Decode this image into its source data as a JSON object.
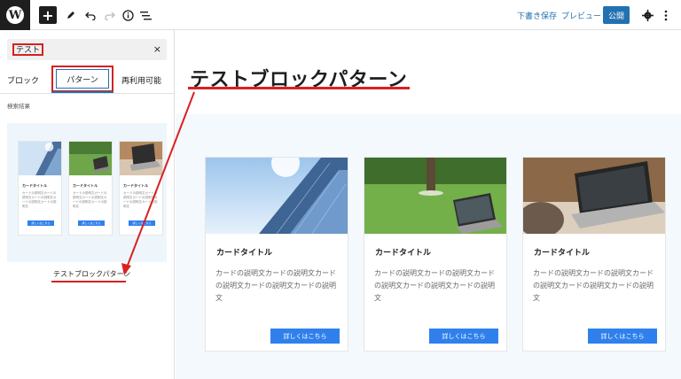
{
  "toolbar": {
    "logo": "W",
    "add_icon": "+",
    "draft_label": "下書き保存",
    "preview_label": "プレビュー",
    "publish_label": "公開"
  },
  "inserter": {
    "search_value": "テスト",
    "clear_icon": "×",
    "tabs": {
      "block": "ブロック",
      "pattern": "パターン",
      "reusable": "再利用可能"
    },
    "results_label": "検索結果",
    "pattern_name": "テストブロックパターン",
    "mini_cards": [
      {
        "title": "カードタイトル",
        "text": "カードの説明文カードの説明文カードの説明文カードの説明文カードの説明文",
        "button": "詳しくはこちら"
      },
      {
        "title": "カードタイトル",
        "text": "カードの説明文カードの説明文カードの説明文カードの説明文カードの説明文",
        "button": "詳しくはこちら"
      },
      {
        "title": "カードタイトル",
        "text": "カードの説明文カードの説明文カードの説明文カードの説明文カードの説明文",
        "button": "詳しくはこちら"
      }
    ]
  },
  "editor": {
    "heading": "テストブロックパターン",
    "cards": [
      {
        "title": "カードタイトル",
        "text": "カードの説明文カードの説明文カードの説明文カードの説明文カードの説明文",
        "button": "詳しくはこちら",
        "image": "building-photo"
      },
      {
        "title": "カードタイトル",
        "text": "カードの説明文カードの説明文カードの説明文カードの説明文カードの説明文",
        "button": "詳しくはこちら",
        "image": "laptop-on-grass-photo"
      },
      {
        "title": "カードタイトル",
        "text": "カードの説明文カードの説明文カードの説明文カードの説明文カードの説明文",
        "button": "詳しくはこちら",
        "image": "laptop-desk-photo"
      }
    ]
  },
  "colors": {
    "accent": "#2271b1",
    "button": "#2f80ed",
    "annotation": "#d92020",
    "group_bg": "#f4f9fd"
  }
}
